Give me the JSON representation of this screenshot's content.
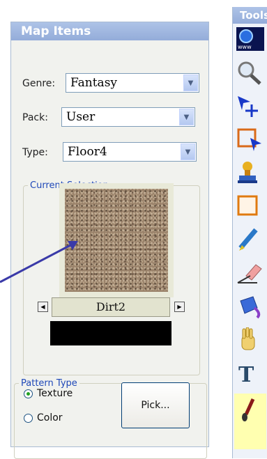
{
  "map_items": {
    "title": "Map Items",
    "genre": {
      "label": "Genre:",
      "value": "Fantasy"
    },
    "pack": {
      "label": "Pack:",
      "value": "User"
    },
    "type": {
      "label": "Type:",
      "value": "Floor4"
    },
    "current_selection": {
      "legend": "Current Selection",
      "name": "Dirt2",
      "prev_icon": "left-arrow-icon",
      "next_icon": "right-arrow-icon",
      "swatch_color": "#000000"
    },
    "pattern_type": {
      "legend": "Pattern Type",
      "options": [
        {
          "label": "Texture",
          "selected": true
        },
        {
          "label": "Color",
          "selected": false
        }
      ],
      "pick_label": "Pick..."
    }
  },
  "tools": {
    "title": "Tools",
    "items": [
      {
        "icon": "www-icon"
      },
      {
        "icon": "magnifier-icon"
      },
      {
        "icon": "select-add-icon"
      },
      {
        "icon": "select-rect-icon"
      },
      {
        "icon": "stamp-icon"
      },
      {
        "icon": "rectangle-icon"
      },
      {
        "icon": "pen-icon"
      },
      {
        "icon": "eraser-icon"
      },
      {
        "icon": "fill-bucket-icon"
      },
      {
        "icon": "hand-icon"
      },
      {
        "icon": "text-icon"
      },
      {
        "icon": "paintbrush-icon"
      }
    ]
  },
  "colors": {
    "title_bar": "#93acd9",
    "legend_text": "#1f48b8",
    "callout_arrow": "#3a3aa8"
  }
}
